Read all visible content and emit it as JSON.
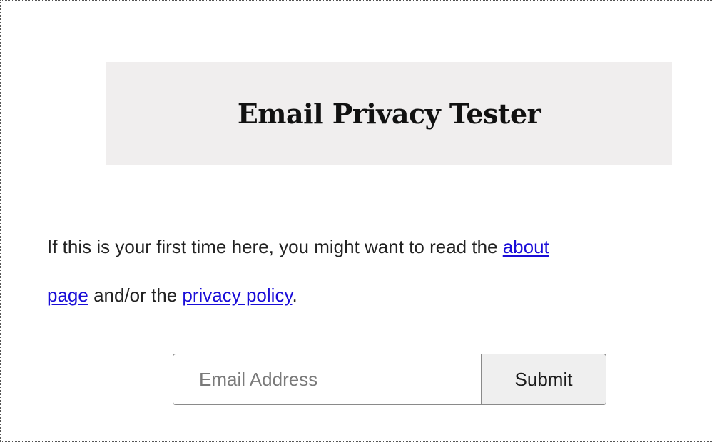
{
  "header": {
    "title": "Email Privacy Tester"
  },
  "intro": {
    "text_before": "If this is your first time here, you might want to read the ",
    "about_link_part1": "about",
    "about_link_part2": "page",
    "text_middle": " and/or the ",
    "privacy_link": "privacy policy",
    "text_after": "."
  },
  "form": {
    "email_placeholder": "Email Address",
    "email_value": "",
    "submit_label": "Submit"
  },
  "colors": {
    "title_box_bg": "#f0eeee",
    "link": "#1a0dd8",
    "button_bg": "#efefef"
  }
}
